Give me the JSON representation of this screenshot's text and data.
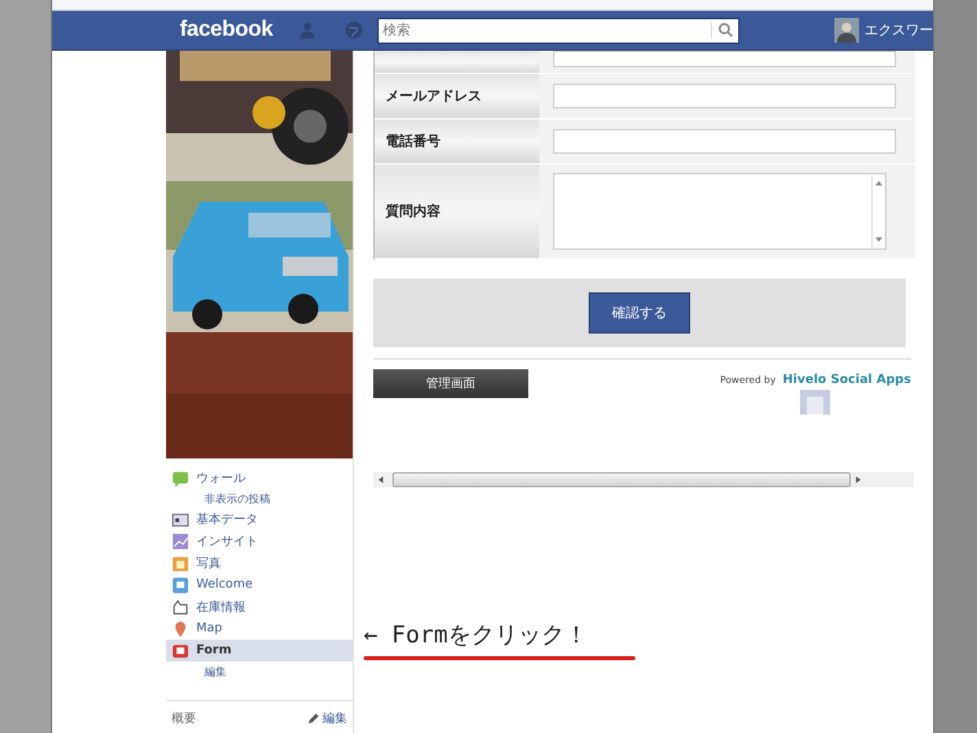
{
  "header": {
    "logo": "facebook",
    "search": {
      "placeholder": "検索"
    },
    "user_name": "エクスワー"
  },
  "sidebar": {
    "nav": [
      {
        "label": "ウォール",
        "selected": false,
        "children": [
          {
            "label": "非表示の投稿",
            "selected": false
          }
        ]
      },
      {
        "label": "基本データ",
        "selected": false
      },
      {
        "label": "インサイト",
        "selected": false
      },
      {
        "label": "写真",
        "selected": false
      },
      {
        "label": "Welcome",
        "selected": false
      },
      {
        "label": "在庫情報",
        "selected": false
      },
      {
        "label": "Map",
        "selected": false
      },
      {
        "label": "Form",
        "selected": true,
        "children": [
          {
            "label": "編集",
            "selected": false
          }
        ]
      }
    ],
    "about": {
      "title": "概要",
      "edit": "編集"
    }
  },
  "form": {
    "fields": [
      {
        "kind": "input"
      },
      {
        "kind": "input",
        "label": "メールアドレス"
      },
      {
        "kind": "input",
        "label": "電話番号"
      },
      {
        "kind": "textarea",
        "label": "質問内容"
      }
    ],
    "submit": "確認する"
  },
  "admin_button": "管理画面",
  "powered_by": {
    "prefix": "Powered by",
    "brand": "Hivelo Social Apps"
  },
  "annotation": {
    "text": "← Formをクリック！"
  }
}
